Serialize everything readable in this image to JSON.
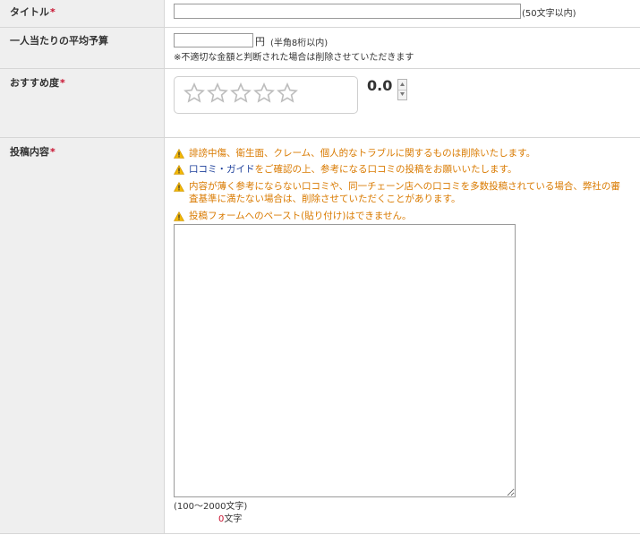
{
  "fields": {
    "title": {
      "label": "タイトル",
      "required_mark": "*",
      "value": "",
      "hint": "(50文字以内)"
    },
    "budget": {
      "label": "一人当たりの平均予算",
      "value": "",
      "unit": "円",
      "hint": "(半角8桁以内)",
      "note": "※不適切な金額と判断された場合は削除させていただきます"
    },
    "rating": {
      "label": "おすすめ度",
      "required_mark": "*",
      "score": "0.0",
      "stars_filled": 0,
      "stars_total": 5
    },
    "content": {
      "label": "投稿内容",
      "required_mark": "*",
      "warnings": [
        {
          "text": "誹謗中傷、衛生面、クレーム、個人的なトラブルに関するものは削除いたします。"
        },
        {
          "link": "口コミ・ガイド",
          "text": "をご確認の上、参考になる口コミの投稿をお願いいたします。"
        },
        {
          "text": "内容が薄く参考にならない口コミや、同一チェーン店への口コミを多数投稿されている場合、弊社の審",
          "text2": "査基準に満たない場合は、削除させていただくことがあります。"
        },
        {
          "text": "投稿フォームへのペースト(貼り付け)はできません。"
        }
      ],
      "value": "",
      "length_hint": "(100〜2000文字)",
      "char_count": "0",
      "char_unit": "文字"
    }
  },
  "colors": {
    "label_bg": "#efefef",
    "required": "#c8102e",
    "warning": "#d97a00",
    "link": "#1a3d99"
  }
}
